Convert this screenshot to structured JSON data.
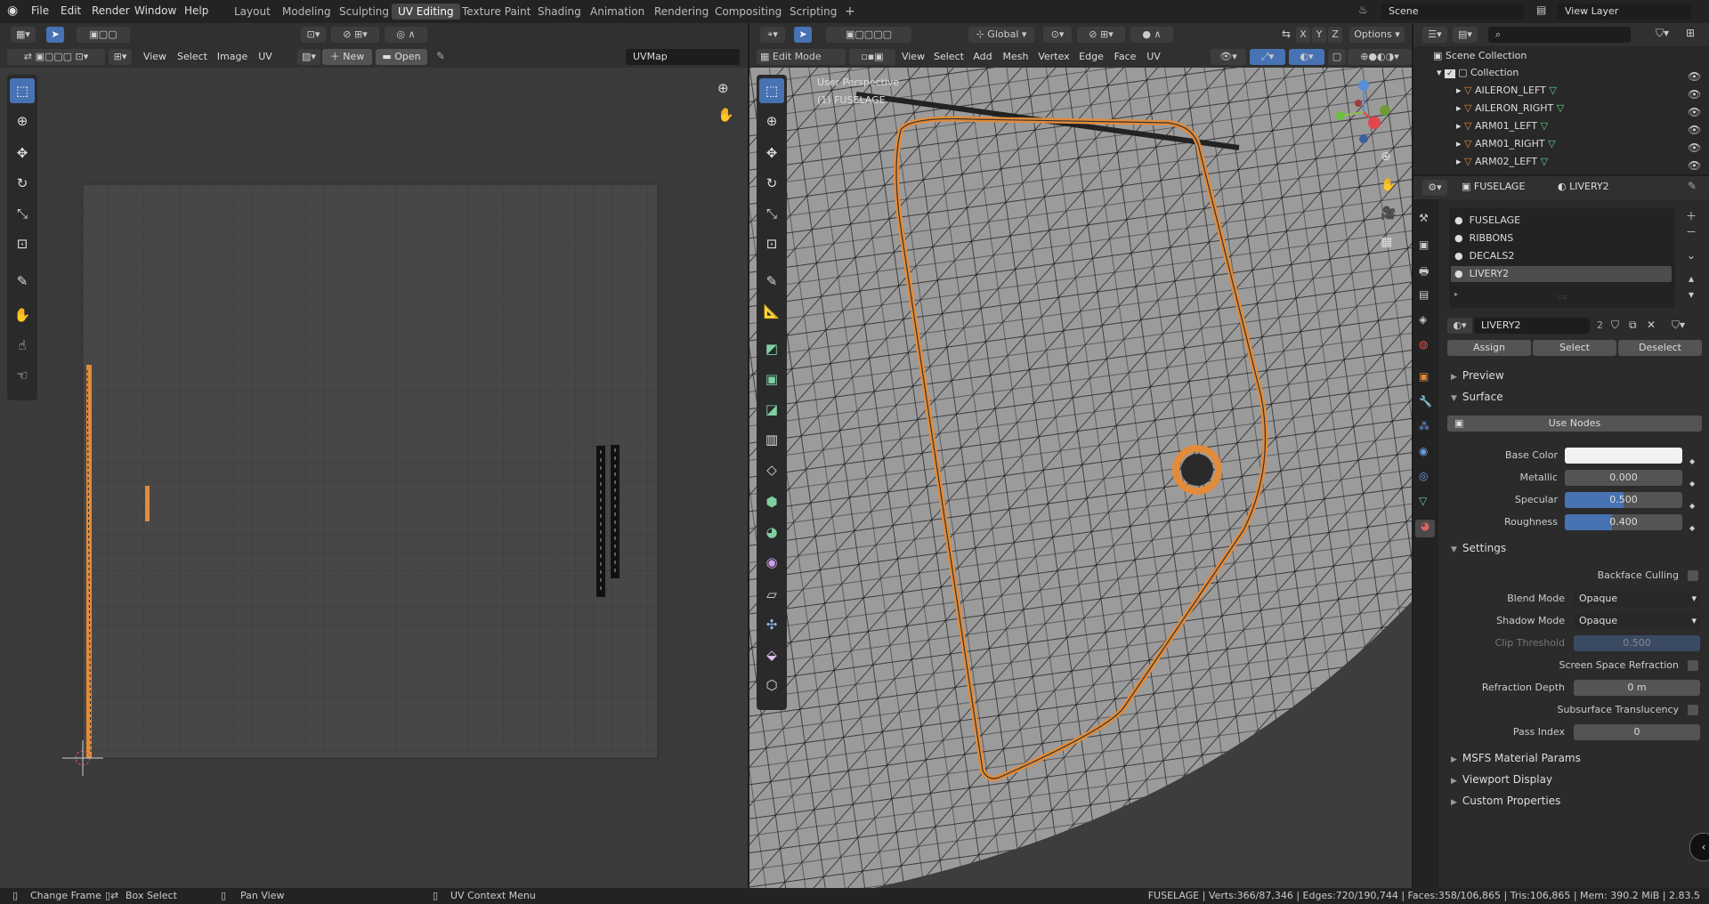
{
  "app": {
    "menus": [
      "File",
      "Edit",
      "Render",
      "Window",
      "Help"
    ],
    "workspaces": [
      "Layout",
      "Modeling",
      "Sculpting",
      "UV Editing",
      "Texture Paint",
      "Shading",
      "Animation",
      "Rendering",
      "Compositing",
      "Scripting"
    ],
    "active_workspace": "UV Editing",
    "add_tab": "+",
    "scene": "Scene",
    "view_layer": "View Layer"
  },
  "uv_editor": {
    "menus": [
      "View",
      "Select",
      "Image",
      "UV"
    ],
    "new_label": "New",
    "open_label": "Open",
    "uvmap": "UVMap"
  },
  "viewport": {
    "mode": "Edit Mode",
    "menus": [
      "View",
      "Select",
      "Add",
      "Mesh",
      "Vertex",
      "Edge",
      "Face",
      "UV"
    ],
    "orientation": "Global",
    "options": "Options",
    "axes": [
      "X",
      "Y",
      "Z"
    ],
    "overlay_line1": "User Perspective",
    "overlay_line2": "(1) FUSELAGE"
  },
  "outliner": {
    "root": "Scene Collection",
    "collection": "Collection",
    "items": [
      "AILERON_LEFT",
      "AILERON_RIGHT",
      "ARM01_LEFT",
      "ARM01_RIGHT",
      "ARM02_LEFT"
    ]
  },
  "properties": {
    "object": "FUSELAGE",
    "material_header": "LIVERY2",
    "slots": [
      "FUSELAGE",
      "RIBBONS",
      "DECALS2",
      "LIVERY2"
    ],
    "active_slot": "LIVERY2",
    "material_name": "LIVERY2",
    "user_count": "2",
    "assign": "Assign",
    "select": "Select",
    "deselect": "Deselect",
    "preview": "Preview",
    "surface": "Surface",
    "use_nodes": "Use Nodes",
    "base_color_label": "Base Color",
    "metallic_label": "Metallic",
    "metallic": "0.000",
    "specular_label": "Specular",
    "specular": "0.500",
    "specular_fraction": 0.5,
    "roughness_label": "Roughness",
    "roughness": "0.400",
    "roughness_fraction": 0.4,
    "settings": "Settings",
    "backface_culling": "Backface Culling",
    "blend_mode_label": "Blend Mode",
    "blend_mode": "Opaque",
    "shadow_mode_label": "Shadow Mode",
    "shadow_mode": "Opaque",
    "clip_threshold_label": "Clip Threshold",
    "clip_threshold": "0.500",
    "screen_space_refraction": "Screen Space Refraction",
    "refraction_depth_label": "Refraction Depth",
    "refraction_depth": "0 m",
    "subsurface_translucency": "Subsurface Translucency",
    "pass_index_label": "Pass Index",
    "pass_index": "0",
    "msfs": "MSFS Material Params",
    "viewport_display": "Viewport Display",
    "custom_properties": "Custom Properties"
  },
  "status": {
    "change_frame": "Change Frame",
    "box_select": "Box Select",
    "pan_view": "Pan View",
    "uv_context_menu": "UV Context Menu",
    "stats": "FUSELAGE | Verts:366/87,346 | Edges:720/190,744 | Faces:358/106,865 | Tris:106,865 | Mem: 390.2 MiB | 2.83.5"
  },
  "colors": {
    "accent": "#4772b3",
    "selection": "#e28b3b",
    "header": "#303030",
    "panel": "#2b2b2b"
  }
}
